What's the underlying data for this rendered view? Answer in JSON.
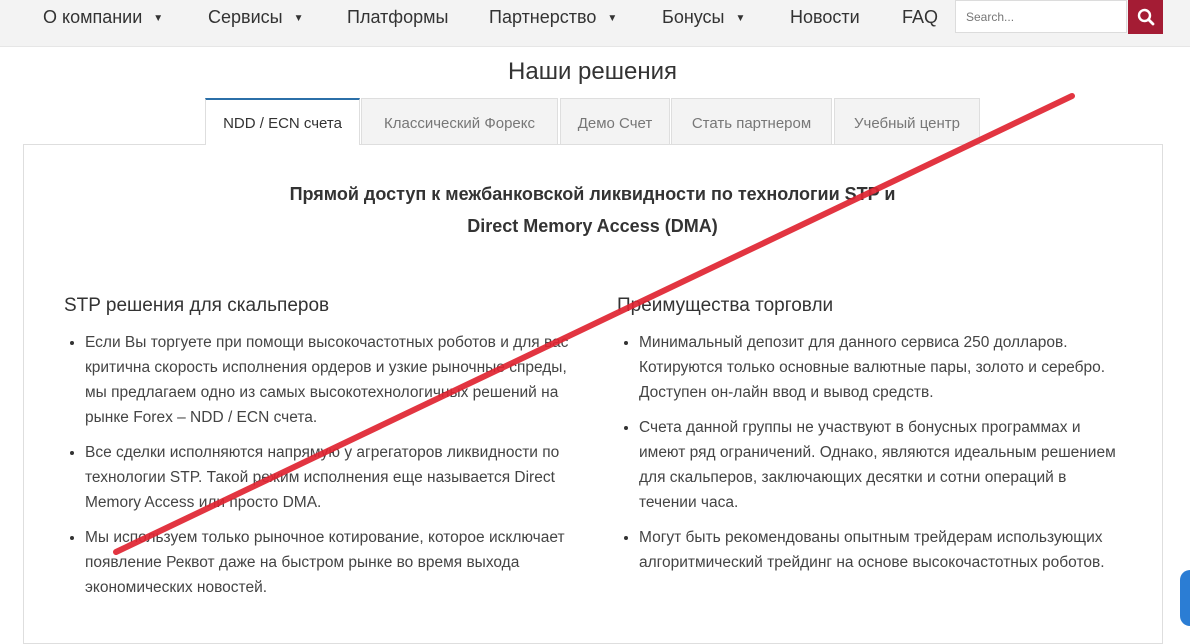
{
  "nav": {
    "items": [
      {
        "label": "О компании",
        "caret": "▼"
      },
      {
        "label": "Сервисы",
        "caret": "▼"
      },
      {
        "label": "Платформы"
      },
      {
        "label": "Партнерство",
        "caret": "▼"
      },
      {
        "label": "Бонусы",
        "caret": "▼"
      },
      {
        "label": "Новости"
      },
      {
        "label": "FAQ"
      }
    ],
    "search": {
      "placeholder": "Search...",
      "value": "",
      "icon": "search-icon"
    },
    "accent_color": "#a41c34"
  },
  "section_title": "Наши решения",
  "tabs": [
    {
      "label": "NDD / ECN счета",
      "active": true
    },
    {
      "label": "Классический Форекс"
    },
    {
      "label": "Демо Счет"
    },
    {
      "label": "Стать партнером"
    },
    {
      "label": "Учебный центр"
    }
  ],
  "headline": {
    "line1": "Прямой доступ к межбанковской ликвидности по технологии STP и",
    "line2": "Direct Memory Access (DMA)"
  },
  "left_column": {
    "title": "STP решения для скальперов",
    "items": [
      "Если Вы торгуете при помощи высокочастотных роботов и для вас критична скорость исполнения ордеров и узкие рыночные спреды, мы предлагаем одно из самых высокотехнологичных решений на рынке Forex – NDD / ECN счета.",
      "Все сделки исполняются напрямую у агрегаторов ликвидности по технологии STP. Такой режим исполнения еще называется Direct Memory Access или просто DMA.",
      "Мы используем только рыночное котирование, которое исключает появление Реквот даже на быстром рынке во время выхода экономических новостей."
    ]
  },
  "right_column": {
    "title": "Преимущества торговли",
    "items": [
      "Минимальный депозит для данного сервиса 250 долларов. Котируются только основные валютные пары, золото и серебро. Доступен он-лайн ввод и вывод средств.",
      "Счета данной группы не участвуют в бонусных программах и имеют ряд ограничений. Однако, являются идеальным решением для скальперов, заключающих десятки и сотни операций в течении часа.",
      "Могут быть рекомендованы опытным трейдерам использующих алгоритмический трейдинг на основе высокочастотных роботов."
    ]
  },
  "overlay": {
    "color": "#e02431"
  }
}
